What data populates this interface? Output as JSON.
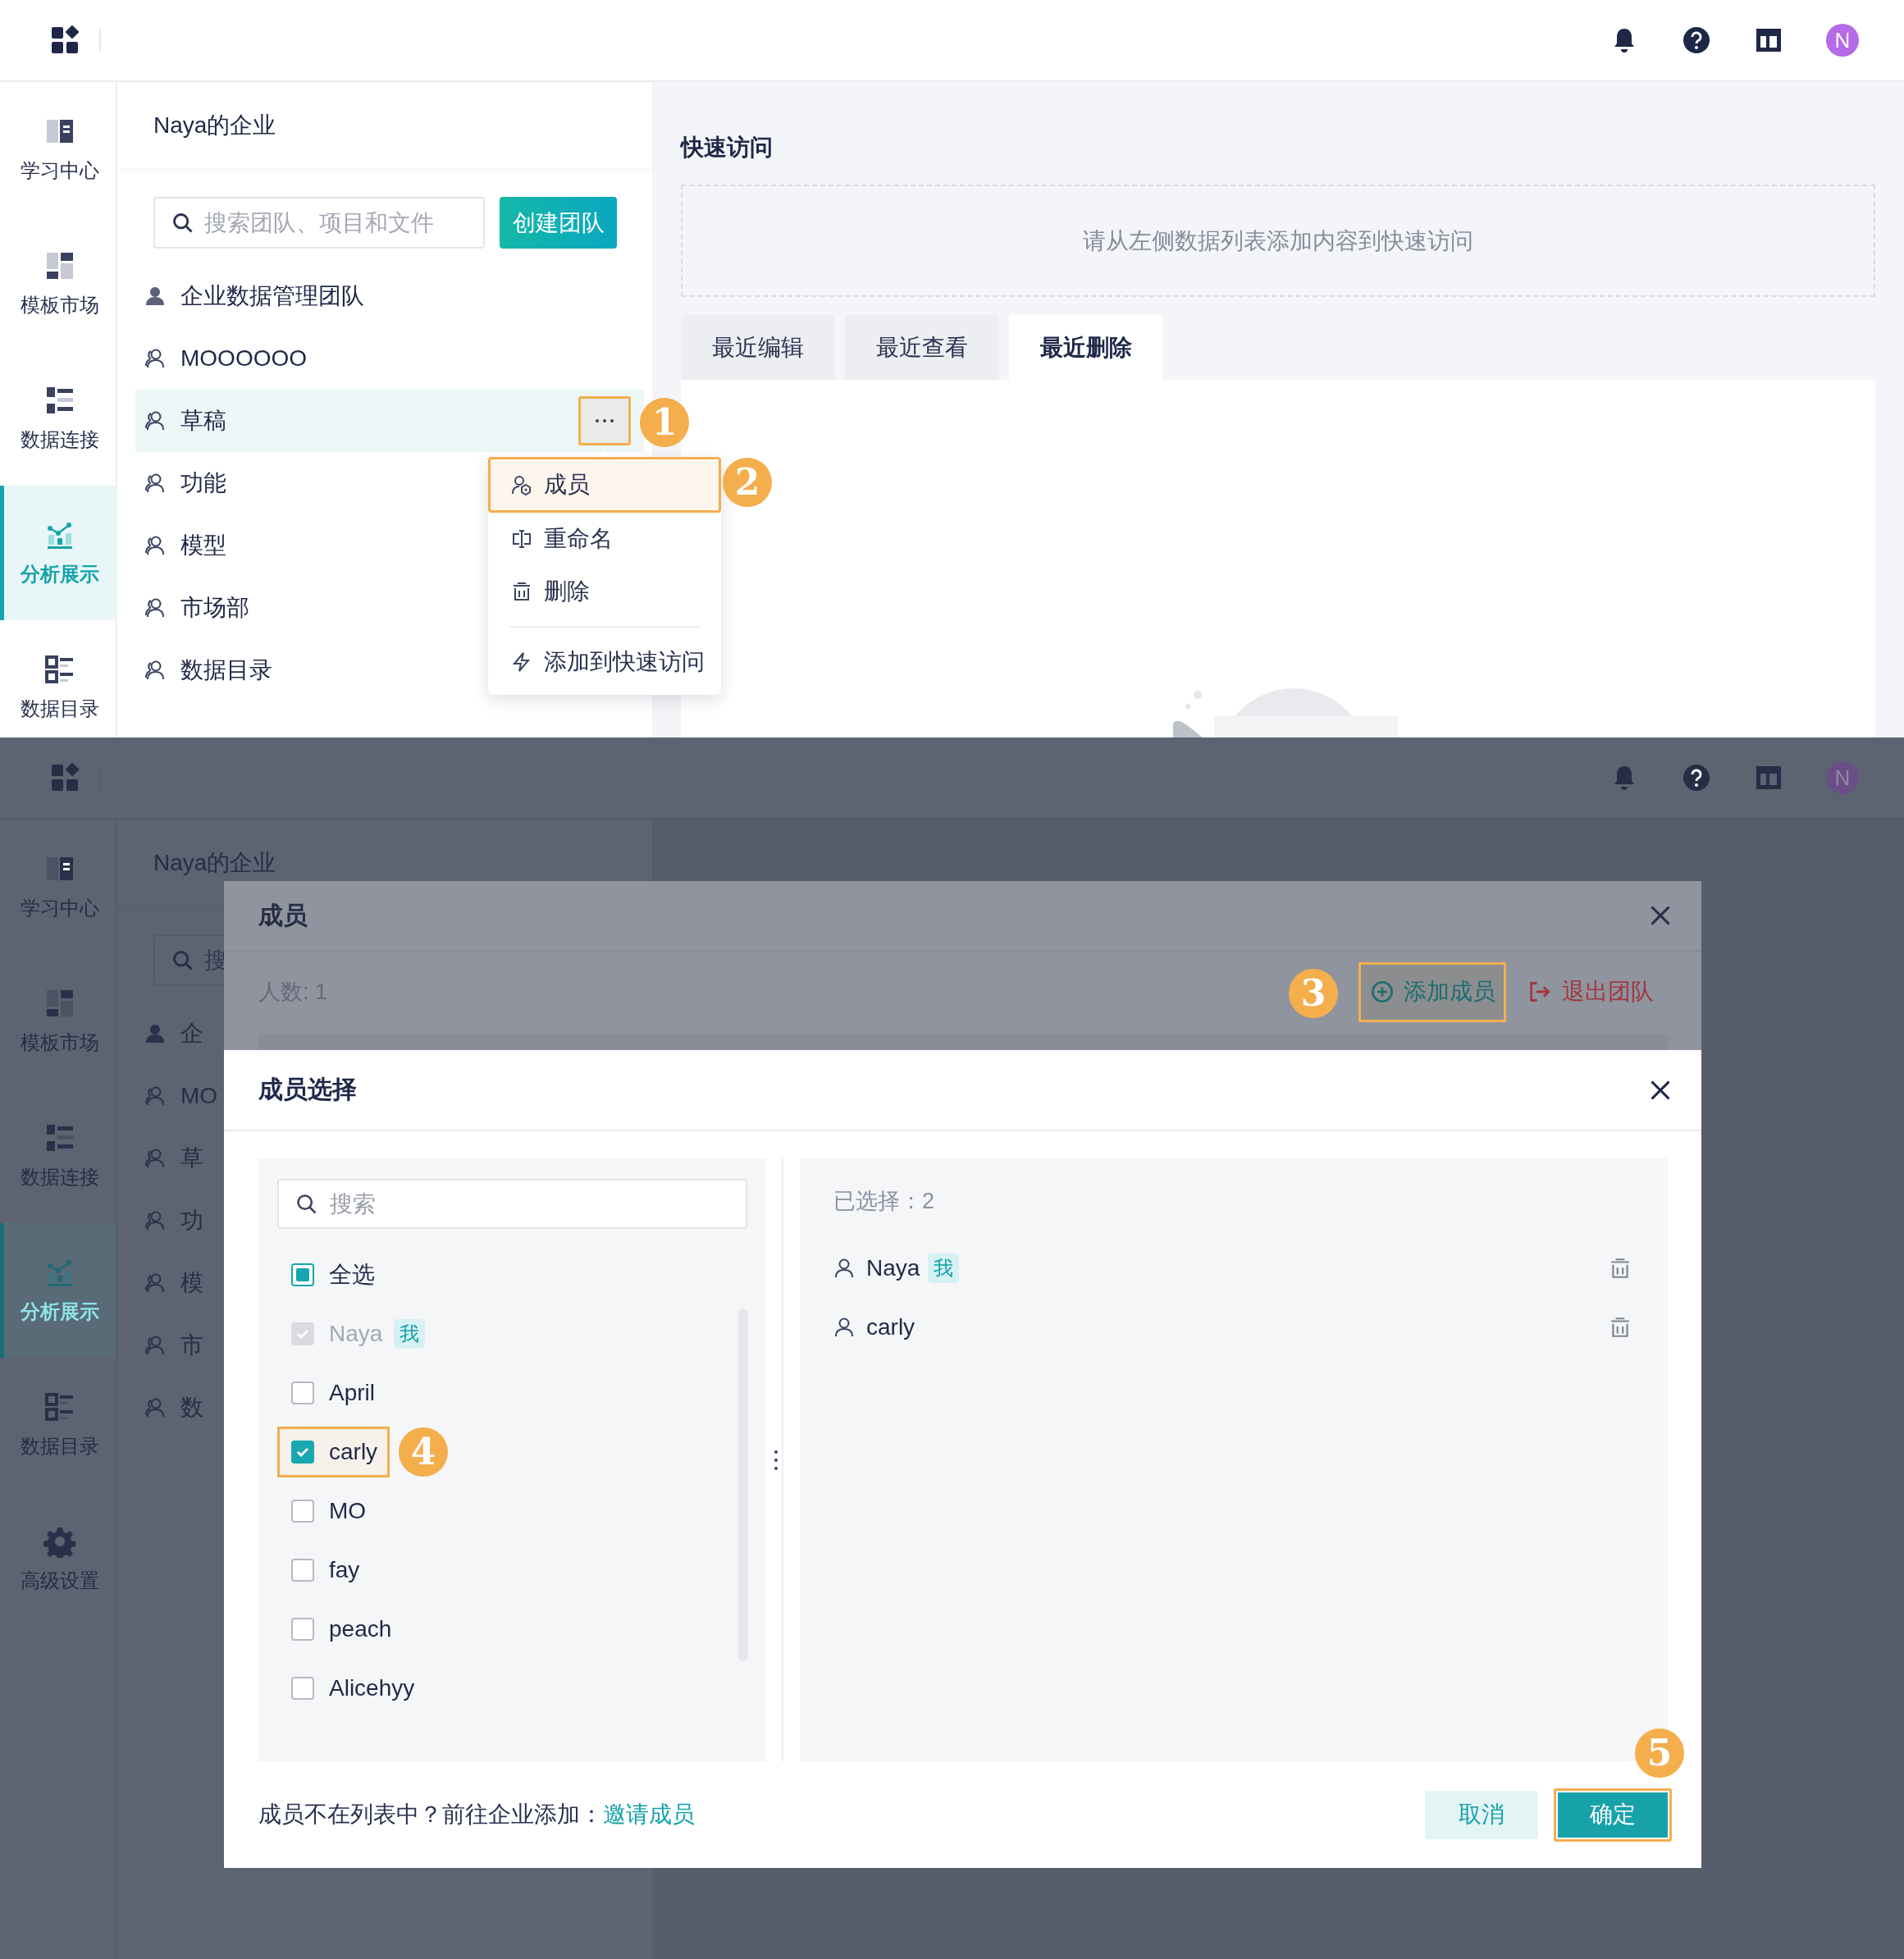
{
  "top_screen": {
    "header": {
      "avatar": "N"
    },
    "sidebar": [
      {
        "label": "学习中心",
        "selected": false
      },
      {
        "label": "模板市场",
        "selected": false
      },
      {
        "label": "数据连接",
        "selected": false
      },
      {
        "label": "分析展示",
        "selected": true
      },
      {
        "label": "数据目录",
        "selected": false
      }
    ],
    "org_name": "Naya的企业",
    "search": {
      "placeholder": "搜索团队、项目和文件"
    },
    "create_button": "创建团队",
    "teams": [
      {
        "name": "企业数据管理团队",
        "selected": false
      },
      {
        "name": "MOOOOOO",
        "selected": false
      },
      {
        "name": "草稿",
        "selected": true
      },
      {
        "name": "功能",
        "selected": false
      },
      {
        "name": "模型",
        "selected": false
      },
      {
        "name": "市场部",
        "selected": false
      },
      {
        "name": "数据目录",
        "selected": false
      }
    ],
    "more_button": {
      "highlighted": true,
      "badge": "1"
    },
    "menu": {
      "badge": "2",
      "items": [
        {
          "label": "成员",
          "highlighted": true
        },
        {
          "label": "重命名",
          "highlighted": false
        },
        {
          "label": "删除",
          "highlighted": false
        },
        {
          "label": "添加到快速访问",
          "highlighted": false
        }
      ]
    },
    "quick_access": {
      "title": "快速访问",
      "empty_text": "请从左侧数据列表添加内容到快速访问"
    },
    "tabs": [
      {
        "label": "最近编辑",
        "selected": false
      },
      {
        "label": "最近查看",
        "selected": false
      },
      {
        "label": "最近删除",
        "selected": true
      }
    ]
  },
  "bottom_screen": {
    "header": {
      "avatar": "N"
    },
    "sidebar": [
      {
        "label": "学习中心",
        "selected": false
      },
      {
        "label": "模板市场",
        "selected": false
      },
      {
        "label": "数据连接",
        "selected": false
      },
      {
        "label": "分析展示",
        "selected": true
      },
      {
        "label": "数据目录",
        "selected": false
      },
      {
        "label": "高级设置",
        "selected": false
      }
    ],
    "org_name": "Naya的企业",
    "search": {
      "placeholder": "搜"
    },
    "teams": [
      {
        "name": "企",
        "selected": false
      },
      {
        "name": "MO",
        "selected": false
      },
      {
        "name": "草",
        "selected": false
      },
      {
        "name": "功",
        "selected": false
      },
      {
        "name": "模",
        "selected": false
      },
      {
        "name": "市",
        "selected": false
      },
      {
        "name": "数",
        "selected": false
      }
    ],
    "members_dialog": {
      "title": "成员",
      "count": "人数: 1",
      "add_button": {
        "label": "添加成员",
        "highlighted": true,
        "badge": "3"
      },
      "leave_button": "退出团队"
    },
    "picker": {
      "title": "成员选择",
      "search": {
        "placeholder": "搜索"
      },
      "select_all": {
        "label": "全选",
        "partial": true
      },
      "members": [
        {
          "name": "Naya",
          "tag": "我",
          "checked": true,
          "disabled": true,
          "highlighted": false
        },
        {
          "name": "April",
          "checked": false,
          "disabled": false,
          "highlighted": false
        },
        {
          "name": "carly",
          "checked": true,
          "disabled": false,
          "highlighted": true,
          "badge": "4"
        },
        {
          "name": "MO",
          "checked": false,
          "disabled": false,
          "highlighted": false
        },
        {
          "name": "fay",
          "checked": false,
          "disabled": false,
          "highlighted": false
        },
        {
          "name": "peach",
          "checked": false,
          "disabled": false,
          "highlighted": false
        },
        {
          "name": "Alicehyy",
          "checked": false,
          "disabled": false,
          "highlighted": false
        }
      ],
      "selected_count": "已选择：2",
      "selected": [
        {
          "name": "Naya",
          "tag": "我"
        },
        {
          "name": "carly"
        }
      ],
      "footer_text": "成员不在列表中？前往企业添加：",
      "invite_link": "邀请成员",
      "cancel_button": "取消",
      "confirm_button": {
        "label": "确定",
        "highlighted": true,
        "badge": "5"
      }
    }
  }
}
